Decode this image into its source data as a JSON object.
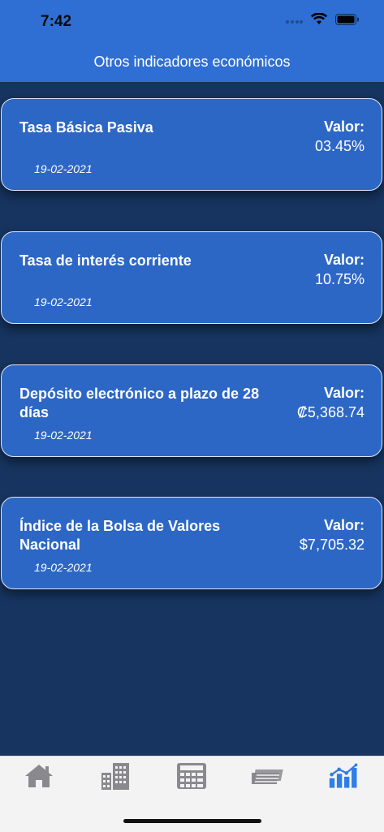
{
  "status_bar": {
    "time": "7:42"
  },
  "header": {
    "title": "Otros indicadores económicos"
  },
  "cards": [
    {
      "title": "Tasa Básica Pasiva",
      "value_label": "Valor:",
      "value": "03.45%",
      "date": "19-02-2021"
    },
    {
      "title": "Tasa de interés corriente",
      "value_label": "Valor:",
      "value": "10.75%",
      "date": "19-02-2021"
    },
    {
      "title": "Depósito electrónico a plazo de 28 días",
      "value_label": "Valor:",
      "value": "₡5,368.74",
      "date": "19-02-2021"
    },
    {
      "title": "Índice de la Bolsa de Valores Nacional",
      "value_label": "Valor:",
      "value": "$7,705.32",
      "date": "19-02-2021"
    }
  ],
  "tabbar": {
    "items": [
      {
        "icon": "home-icon",
        "active": false
      },
      {
        "icon": "buildings-icon",
        "active": false
      },
      {
        "icon": "calculator-icon",
        "active": false
      },
      {
        "icon": "money-icon",
        "active": false
      },
      {
        "icon": "chart-icon",
        "active": true
      }
    ]
  },
  "colors": {
    "header": "#2f6fd3",
    "background": "#16345f",
    "card": "#2d67c5",
    "tab_active": "#2f7ee6",
    "tab_inactive": "#8a8a8e"
  }
}
